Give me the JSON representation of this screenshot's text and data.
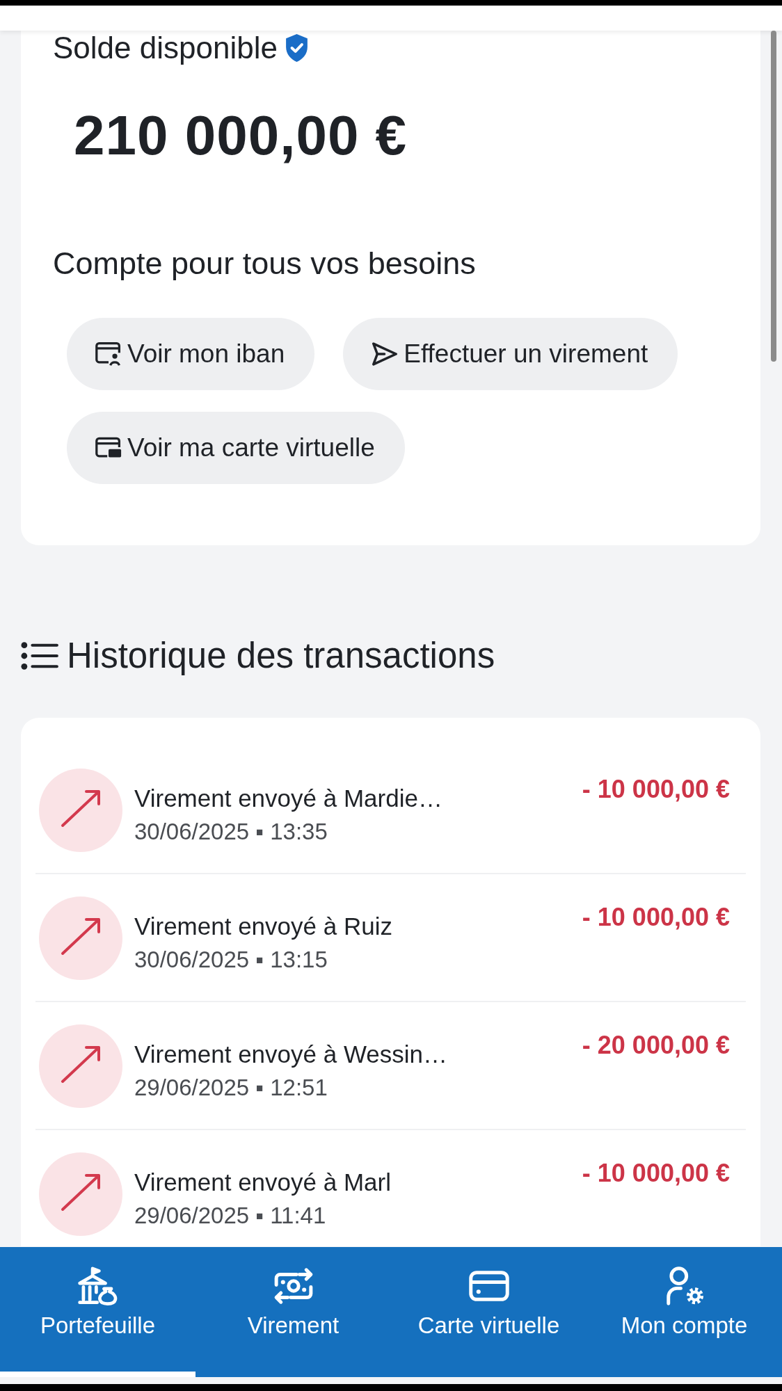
{
  "balance": {
    "label": "Solde disponible",
    "verified": true,
    "amount": "210 000,00 €"
  },
  "account": {
    "title": "Compte pour tous vos besoins",
    "actions": [
      {
        "kind": "iban",
        "label": "Voir mon iban"
      },
      {
        "kind": "transfer",
        "label": "Effectuer un virement"
      },
      {
        "kind": "card",
        "label": "Voir ma carte virtuelle"
      }
    ]
  },
  "history": {
    "title": "Historique des transactions",
    "transactions": [
      {
        "kind": "outgoing",
        "title": "Virement envoyé à Mardie…",
        "datetime": "30/06/2025 ▪ 13:35",
        "amount": "- 10 000,00 €"
      },
      {
        "kind": "outgoing",
        "title": "Virement envoyé à Ruiz",
        "datetime": "30/06/2025 ▪ 13:15",
        "amount": "- 10 000,00 €"
      },
      {
        "kind": "outgoing",
        "title": "Virement envoyé à Wessin…",
        "datetime": "29/06/2025 ▪ 12:51",
        "amount": "- 20 000,00 €"
      },
      {
        "kind": "outgoing",
        "title": "Virement envoyé à Marl",
        "datetime": "29/06/2025 ▪ 11:41",
        "amount": "- 10 000,00 €"
      }
    ]
  },
  "nav": [
    {
      "kind": "wallet",
      "label": "Portefeuille",
      "selected": true
    },
    {
      "kind": "transfer",
      "label": "Virement",
      "selected": false
    },
    {
      "kind": "card",
      "label": "Carte virtuelle",
      "selected": false
    },
    {
      "kind": "account",
      "label": "Mon compte",
      "selected": false
    }
  ]
}
